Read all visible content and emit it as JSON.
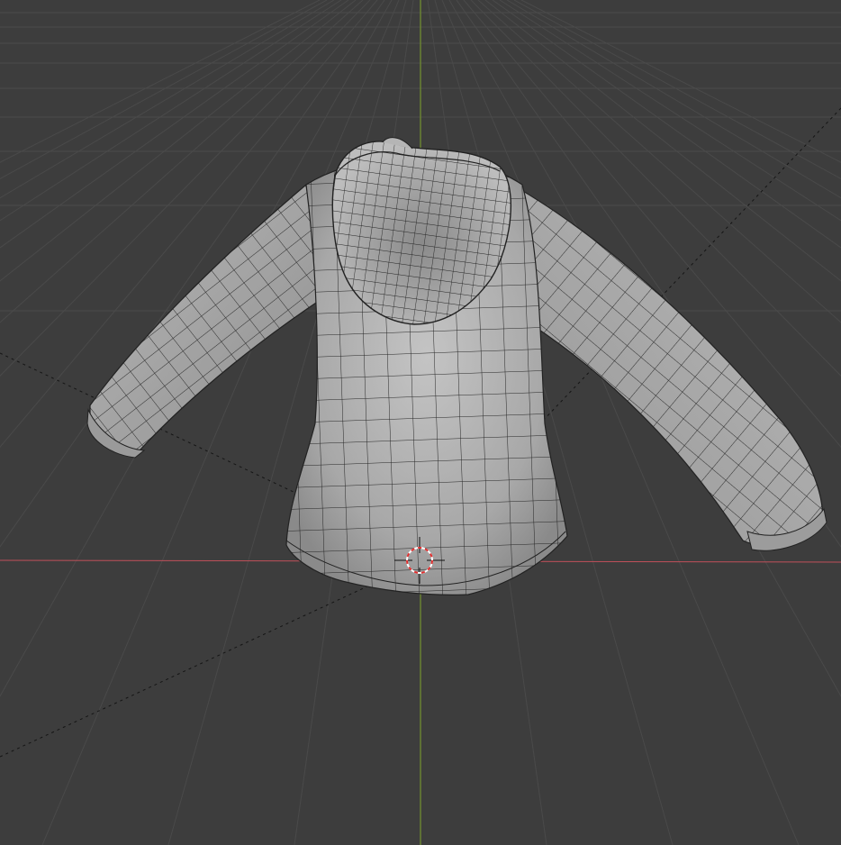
{
  "viewport": {
    "view": "3D Viewport",
    "shading": "solid",
    "overlays": {
      "wireframe": true,
      "grid_floor": true
    },
    "colors": {
      "background": "#3d3d3d",
      "grid": "#4a4a4a",
      "x_axis": "#d0545c",
      "y_axis": "#87ab2c",
      "mesh_fill": "#a9a9a9",
      "mesh_shadow": "#7c7c7c",
      "mesh_highlight": "#c9c9c9",
      "wire": "#1a1a1a",
      "cursor_red": "#e03030",
      "cursor_white": "#ffffff"
    }
  },
  "scene": {
    "object": {
      "kind": "mesh",
      "shape": "hoodie",
      "icon": "mesh-icon"
    },
    "cursor": {
      "icon": "3d-cursor-icon"
    }
  }
}
